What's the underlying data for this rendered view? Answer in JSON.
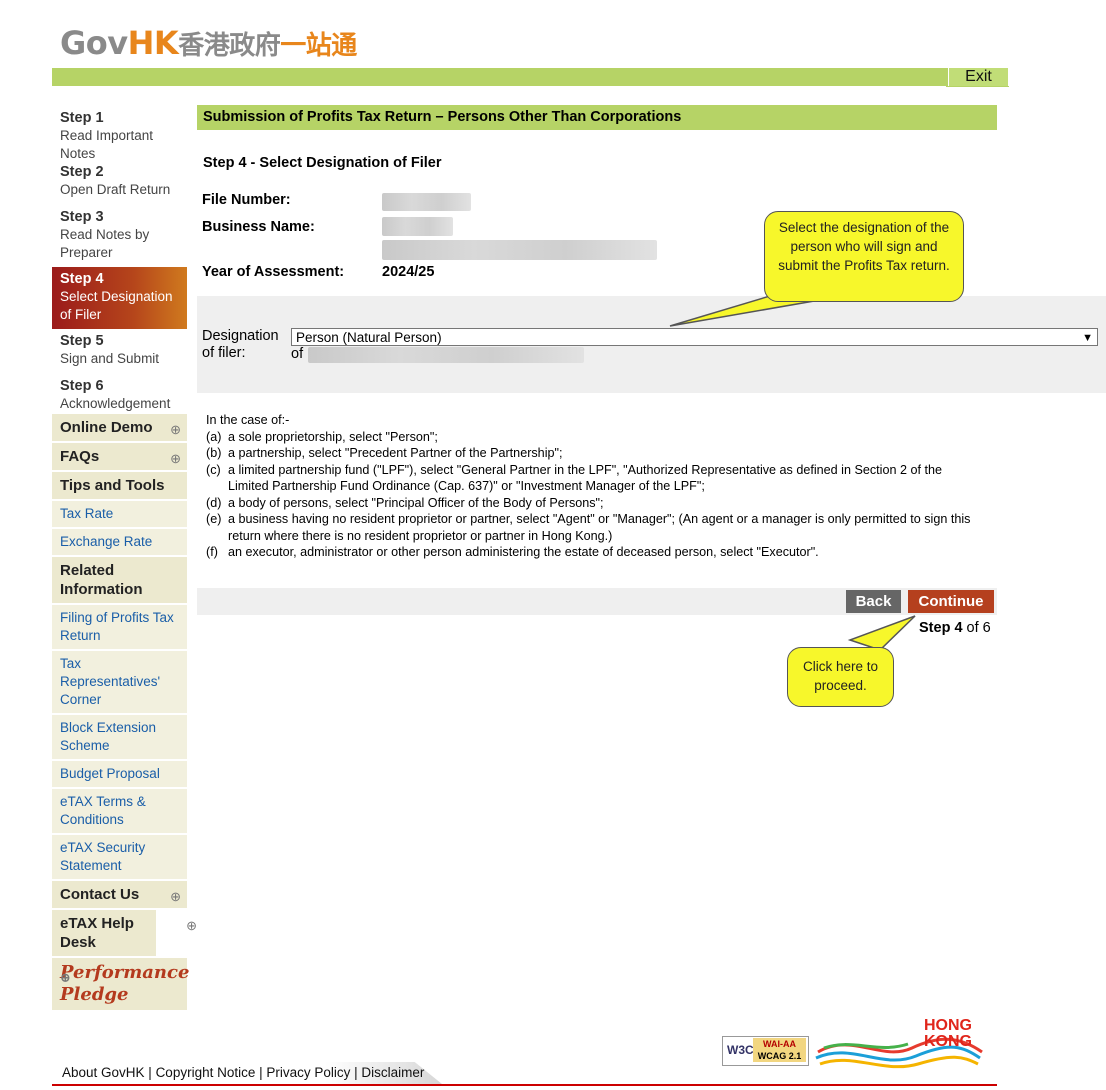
{
  "header": {
    "logo_en_gov": "Gov",
    "logo_en_hk": "HK",
    "logo_cn_a": "香港政府",
    "logo_cn_b": "一站通",
    "exit_label": "Exit"
  },
  "sidebar": {
    "steps": [
      {
        "step": "Step 1",
        "label": "Read Important Notes"
      },
      {
        "step": "Step 2",
        "label": "Open Draft Return"
      },
      {
        "step": "Step 3",
        "label": "Read Notes by Preparer"
      },
      {
        "step": "Step 4",
        "label": "Select Designation of Filer"
      },
      {
        "step": "Step 5",
        "label": "Sign and Submit"
      },
      {
        "step": "Step 6",
        "label": "Acknowledgement"
      }
    ],
    "online_demo": "Online Demo",
    "faqs": "FAQs",
    "tips_tools": "Tips and Tools",
    "tax_rate": "Tax Rate",
    "exchange_rate": "Exchange Rate",
    "related_info": "Related Information",
    "related_links": [
      "Filing of Profits Tax Return",
      "Tax Representatives' Corner",
      "Block Extension Scheme",
      "Budget Proposal",
      "eTAX Terms & Conditions",
      "eTAX Security Statement"
    ],
    "contact_us": "Contact Us",
    "etax_help": "eTAX Help Desk",
    "performance_pledge": "Performance Pledge"
  },
  "main": {
    "title": "Submission of Profits Tax Return – Persons Other Than Corporations",
    "step_heading": "Step 4 - Select Designation of Filer",
    "file_number_label": "File Number:",
    "business_name_label": "Business Name:",
    "year_label": "Year of Assessment:",
    "year_value": "2024/25",
    "designation_label_1": "Designation",
    "designation_label_2": "of filer:",
    "designation_selected": "Person (Natural Person)",
    "of_label": "of",
    "notes_intro": "In the case of:-",
    "notes": [
      {
        "k": "(a)",
        "t": "a sole proprietorship, select \"Person\";"
      },
      {
        "k": "(b)",
        "t": "a partnership, select \"Precedent Partner of the Partnership\";"
      },
      {
        "k": "(c)",
        "t": "a limited partnership fund (\"LPF\"), select \"General Partner in the LPF\", \"Authorized Representative as defined in Section 2 of the Limited Partnership Fund Ordinance (Cap. 637)\" or \"Investment Manager of the LPF\";"
      },
      {
        "k": "(d)",
        "t": "a body of persons, select \"Principal Officer of the Body of Persons\";"
      },
      {
        "k": "(e)",
        "t": "a business having no resident proprietor or partner, select \"Agent\" or \"Manager\"; (An agent or a manager is only permitted to sign this return where there is no resident proprietor or partner in Hong Kong.)"
      },
      {
        "k": "(f)",
        "t": "an executor, administrator or other person administering the estate of deceased person, select \"Executor\"."
      }
    ],
    "back_label": "Back",
    "continue_label": "Continue",
    "progress_step": "Step 4",
    "progress_of": "of 6",
    "callout_designation": "Select the designation of the person who will sign and submit the Profits Tax return.",
    "callout_continue": "Click here to proceed."
  },
  "footer": {
    "about": "About GovHK",
    "copyright": "Copyright Notice",
    "privacy": "Privacy Policy",
    "disclaimer": "Disclaimer",
    "w3c": "W3C",
    "wai": "WAI-AA",
    "wcag": "WCAG 2.1",
    "hk_logo_1": "HONG",
    "hk_logo_2": "KONG"
  },
  "colors": {
    "accent_green": "#b6d366",
    "active_step": "#9b1b1b",
    "continue_btn": "#b5401e",
    "back_btn": "#666666",
    "link": "#1a5ea8",
    "callout": "#f7f72b"
  }
}
